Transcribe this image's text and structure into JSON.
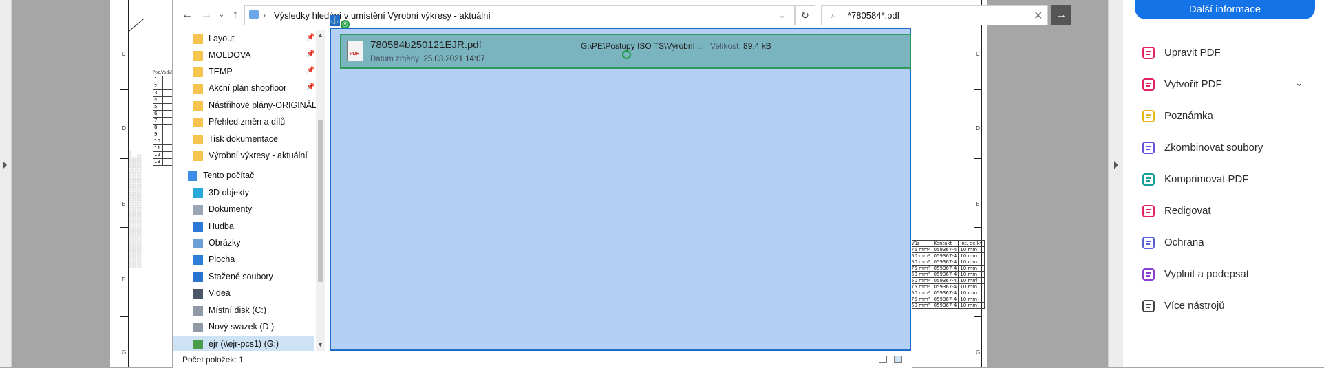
{
  "explorer": {
    "address_path": "Výsledky hledání v umístění Výrobní výkresy - aktuální",
    "search_query": "*780584*.pdf",
    "nav_items": [
      {
        "label": "Layout",
        "pinned": true
      },
      {
        "label": "MOLDOVA",
        "pinned": true
      },
      {
        "label": "TEMP",
        "pinned": true
      },
      {
        "label": "Akční plán shopfloor",
        "pinned": true
      },
      {
        "label": "Nástřihové plány-ORIGINÁL"
      },
      {
        "label": "Přehled změn a dílů"
      },
      {
        "label": "Tisk dokumentace"
      },
      {
        "label": "Výrobní výkresy - aktuální"
      },
      {
        "label": "Tento počítač"
      },
      {
        "label": "3D objekty"
      },
      {
        "label": "Dokumenty"
      },
      {
        "label": "Hudba"
      },
      {
        "label": "Obrázky"
      },
      {
        "label": "Plocha"
      },
      {
        "label": "Stažené soubory"
      },
      {
        "label": "Videa"
      },
      {
        "label": "Místní disk (C:)"
      },
      {
        "label": "Nový svazek (D:)"
      },
      {
        "label": "ejr (\\\\ejr-pcs1) (G:)"
      }
    ],
    "result": {
      "name": "780584b250121EJR.pdf",
      "date_label": "Datum změny:",
      "date_value": "25.03.2021 14:07",
      "location": "G:\\PE\\Postupy ISO TS\\Výrobní ...",
      "size_label": "Velikost:",
      "size_value": "89,4 kB",
      "icon": "pdf-file-icon"
    },
    "status": "Počet položek: 1"
  },
  "tools": {
    "more_info": "Další informace",
    "items": [
      {
        "label": "Upravit PDF",
        "icon": "edit-pdf-icon",
        "color": "#e0245e"
      },
      {
        "label": "Vytvořit PDF",
        "icon": "create-pdf-icon",
        "color": "#e0245e"
      },
      {
        "label": "Poznámka",
        "icon": "comment-icon",
        "color": "#e3b618"
      },
      {
        "label": "Zkombinovat soubory",
        "icon": "combine-files-icon",
        "color": "#6a4dd8"
      },
      {
        "label": "Komprimovat PDF",
        "icon": "compress-pdf-icon",
        "color": "#14a098"
      },
      {
        "label": "Redigovat",
        "icon": "redact-icon",
        "color": "#e0245e"
      },
      {
        "label": "Ochrana",
        "icon": "protect-icon",
        "color": "#5a5fd6"
      },
      {
        "label": "Vyplnit a podepsat",
        "icon": "fill-sign-icon",
        "color": "#8a3fd1"
      },
      {
        "label": "Více nástrojů",
        "icon": "more-tools-icon",
        "color": "#444444"
      }
    ]
  },
  "pdf_drawing": {
    "frame_letters": [
      "C",
      "D",
      "E",
      "F",
      "G"
    ],
    "right_table_headers": [
      "Vůz",
      "Kontakt",
      "Int. délky"
    ],
    "right_table_rows": [
      [
        "75 mm²",
        "059367-4",
        "10 mm"
      ],
      [
        "50 mm²",
        "059367-4",
        "10 mm"
      ],
      [
        "50 mm²",
        "059367-4",
        "10 mm"
      ],
      [
        "75 mm²",
        "059367-4",
        "10 mm"
      ],
      [
        "50 mm²",
        "059367-4",
        "10 mm"
      ],
      [
        "50 mm²",
        "059367-4",
        "10 mm"
      ],
      [
        "75 mm²",
        "059367-4",
        "10 mm"
      ],
      [
        "50 mm²",
        "059367-4",
        "10 mm"
      ],
      [
        "75 mm²",
        "059367-4",
        "10 mm"
      ],
      [
        "50 mm²",
        "059367-4",
        "10 mm"
      ]
    ],
    "left_table_header": "Poz.Vodič",
    "left_table_rows": [
      "1",
      "2",
      "3",
      "4",
      "5",
      "6",
      "7",
      "8",
      "9",
      "10",
      "11",
      "12",
      "13"
    ]
  }
}
